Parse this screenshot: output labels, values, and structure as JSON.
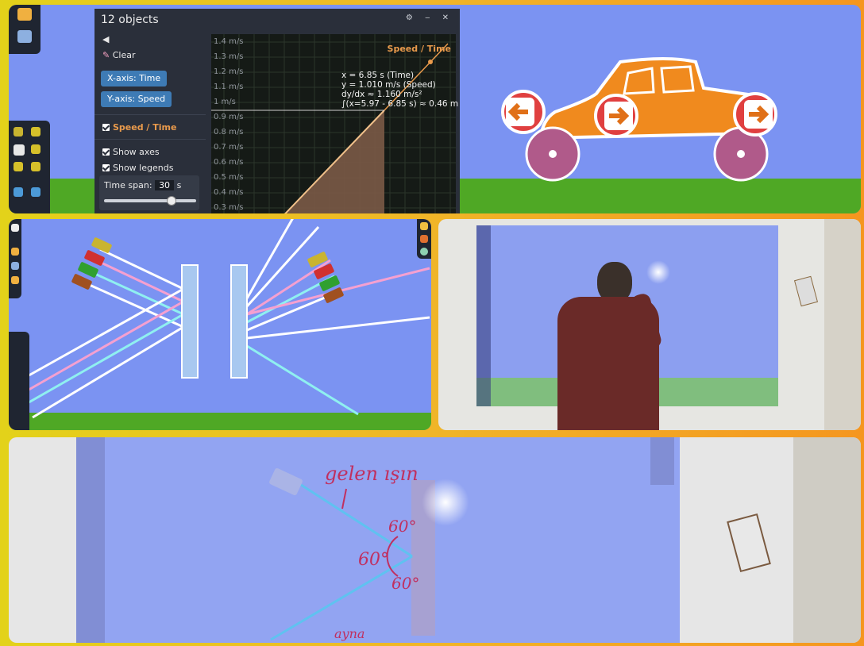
{
  "objects_panel": {
    "title": "12 objects",
    "controls": "⚙ ‒ ✕",
    "back_arrow": "◀",
    "clear_label": "Clear",
    "x_axis_button": "X-axis: Time",
    "y_axis_button": "Y-axis: Speed",
    "plot_checkbox_label": "Speed / Time",
    "show_axes_label": "Show axes",
    "show_legends_label": "Show legends",
    "time_span_label": "Time span:",
    "time_span_value": "30",
    "time_span_unit": "s",
    "time_span_slider_level": 0.72
  },
  "graph": {
    "title": "Speed / Time",
    "y_ticks": [
      "1.4 m/s",
      "1.3 m/s",
      "1.2 m/s",
      "1.1 m/s",
      "1 m/s",
      "0.9 m/s",
      "0.8 m/s",
      "0.7 m/s",
      "0.6 m/s",
      "0.5 m/s",
      "0.4 m/s",
      "0.3 m/s"
    ],
    "readout_x": "x = 6.85 s (Time)",
    "readout_y": "y = 1.010 m/s (Speed)",
    "readout_slope": "dy/dx ≈ 1.160 m/s²",
    "readout_integral": "∫(x=5.97 - 6.85 s) ≈ 0.46 m",
    "accent_color": "#e99a4c"
  },
  "scene_colors": {
    "frame_gradient": [
      "#e3d21a",
      "#f5961f"
    ],
    "sky": "#7b93f2",
    "ground": "#4fa825",
    "car_body": "#f08a1e",
    "wheel": "#b05a8a",
    "light_beam": "#ffffff"
  },
  "handwriting": {
    "label": "gelen ışın",
    "angle_top": "60°",
    "angle_left": "60°",
    "angle_bottom": "60°",
    "mirror_label": "ayna"
  },
  "icons": {
    "arrow_left": "left-arrow-icon",
    "arrow_right": "right-arrow-icon",
    "pencil": "pencil-icon",
    "eraser": "eraser-icon"
  }
}
